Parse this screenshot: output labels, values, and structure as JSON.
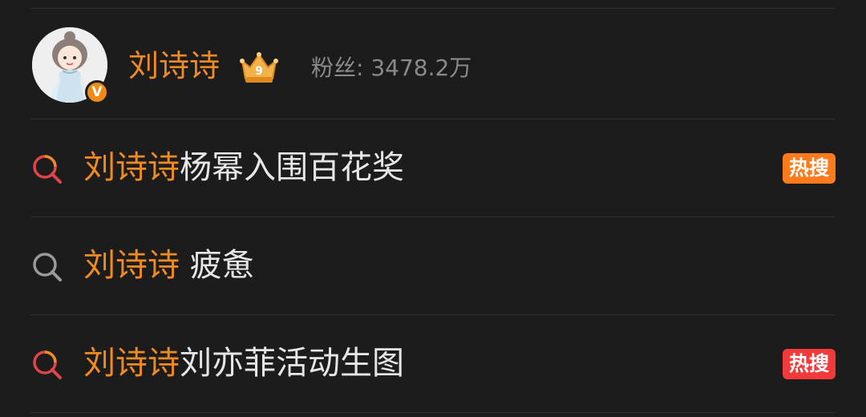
{
  "user": {
    "name": "刘诗诗",
    "verified_badge": "V",
    "crown_level": "9",
    "fans": "粉丝: 3478.2万"
  },
  "suggestions": [
    {
      "highlight": "刘诗诗",
      "rest": "杨幂入围百花奖",
      "icon": "hot-search-icon",
      "badge": "热搜",
      "badge_color": "#ff7a1a"
    },
    {
      "highlight": "刘诗诗",
      "rest": " 疲惫",
      "icon": "search-icon",
      "badge": "",
      "badge_color": ""
    },
    {
      "highlight": "刘诗诗",
      "rest": "刘亦菲活动生图",
      "icon": "hot-search-icon",
      "badge": "热搜",
      "badge_color": "#f23a3a"
    }
  ],
  "colors": {
    "background": "#1c1c1c",
    "highlight": "#f08a24",
    "text": "#e6e6e6",
    "muted": "#8a8a8a",
    "hot_icon_arc": "#f08a24",
    "hot_icon_ring": "#e0454a",
    "plain_icon": "#9a9a9a"
  }
}
